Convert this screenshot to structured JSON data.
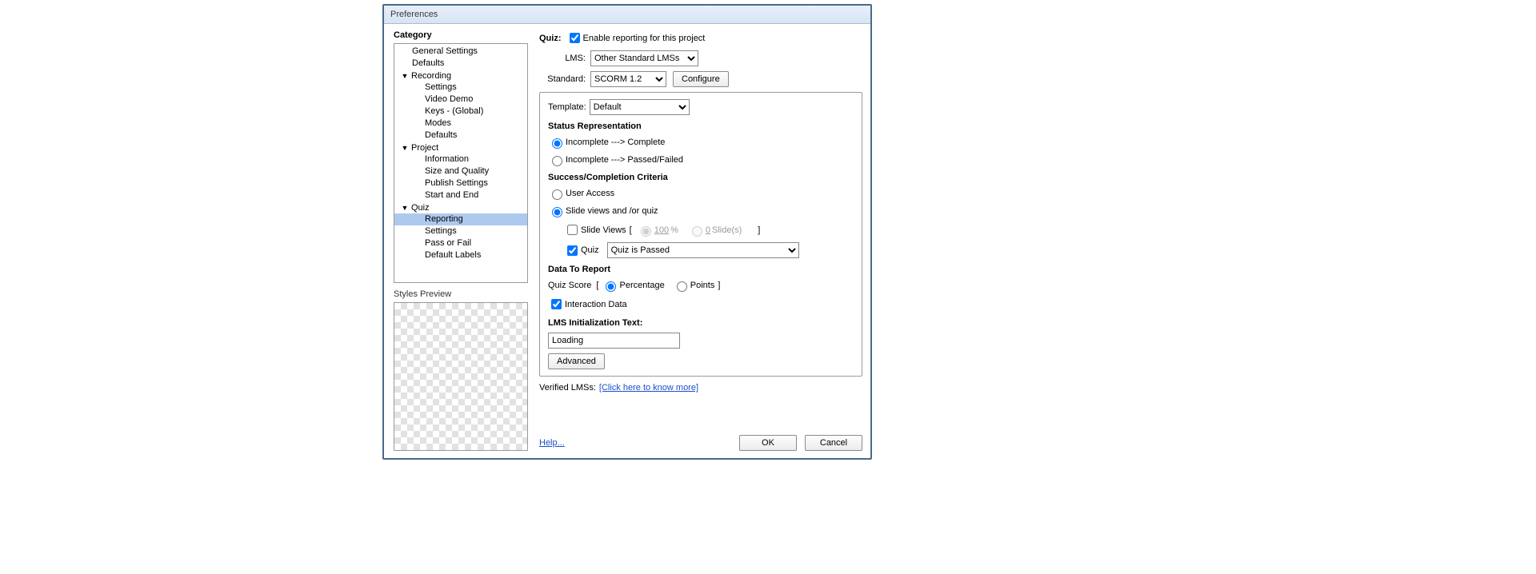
{
  "window": {
    "title": "Preferences"
  },
  "left": {
    "category_heading": "Category",
    "preview_heading": "Styles Preview",
    "tree": {
      "general": "General Settings",
      "defaults_top": "Defaults",
      "recording": "Recording",
      "recording_children": {
        "settings": "Settings",
        "video_demo": "Video Demo",
        "keys": "Keys - (Global)",
        "modes": "Modes",
        "defaults": "Defaults"
      },
      "project": "Project",
      "project_children": {
        "information": "Information",
        "size_quality": "Size and Quality",
        "publish": "Publish Settings",
        "start_end": "Start and End"
      },
      "quiz": "Quiz",
      "quiz_children": {
        "reporting": "Reporting",
        "settings": "Settings",
        "pass_fail": "Pass or Fail",
        "default_labels": "Default Labels"
      }
    }
  },
  "main": {
    "quiz_label": "Quiz:",
    "enable_reporting": "Enable reporting for this project",
    "lms_label": "LMS:",
    "lms_value": "Other Standard LMSs",
    "standard_label": "Standard:",
    "standard_value": "SCORM 1.2",
    "configure_btn": "Configure",
    "template_label": "Template:",
    "template_value": "Default",
    "status_heading": "Status Representation",
    "status_opt1": "Incomplete ---> Complete",
    "status_opt2": "Incomplete ---> Passed/Failed",
    "criteria_heading": "Success/Completion Criteria",
    "criteria_opt1": "User Access",
    "criteria_opt2": "Slide views and /or quiz",
    "slide_views_label": "Slide Views",
    "slide_pct": "100",
    "slide_pct_unit": "%",
    "slide_count": "0",
    "slide_count_unit": "Slide(s)",
    "quiz_check": "Quiz",
    "quiz_condition": "Quiz is Passed",
    "report_heading": "Data To Report",
    "quiz_score_label": "Quiz Score",
    "percentage": "Percentage",
    "points": "Points",
    "interaction_data": "Interaction Data",
    "lms_init_heading": "LMS Initialization Text:",
    "lms_init_value": "Loading",
    "advanced_btn": "Advanced",
    "verified_label": "Verified LMSs:",
    "verified_link": "[Click here to know more]"
  },
  "footer": {
    "help": "Help...",
    "ok": "OK",
    "cancel": "Cancel"
  }
}
